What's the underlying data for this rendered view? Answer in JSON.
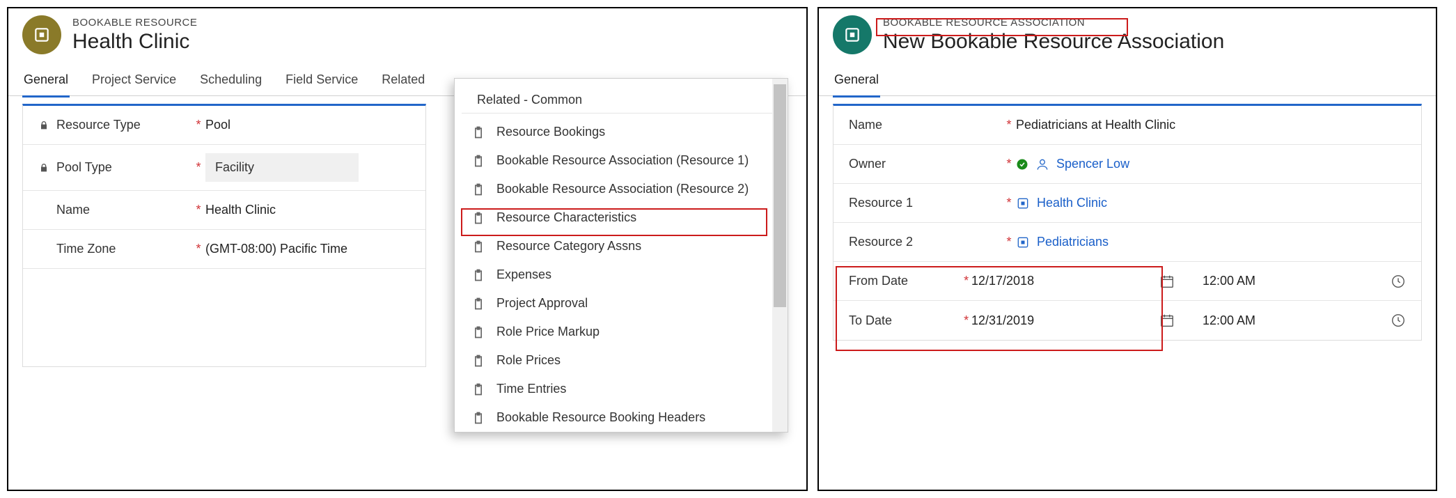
{
  "left": {
    "entity_label": "BOOKABLE RESOURCE",
    "entity_title": "Health Clinic",
    "tabs": [
      "General",
      "Project Service",
      "Scheduling",
      "Field Service",
      "Related"
    ],
    "fields": {
      "resource_type": {
        "label": "Resource Type",
        "value": "Pool"
      },
      "pool_type": {
        "label": "Pool Type",
        "value": "Facility"
      },
      "name": {
        "label": "Name",
        "value": "Health Clinic"
      },
      "time_zone": {
        "label": "Time Zone",
        "value": "(GMT-08:00) Pacific Time"
      }
    },
    "dropdown": {
      "header": "Related - Common",
      "items": [
        "Resource Bookings",
        "Bookable Resource Association (Resource 1)",
        "Bookable Resource Association (Resource 2)",
        "Resource Characteristics",
        "Resource Category Assns",
        "Expenses",
        "Project Approval",
        "Role Price Markup",
        "Role Prices",
        "Time Entries",
        "Bookable Resource Booking Headers"
      ]
    }
  },
  "right": {
    "entity_label": "BOOKABLE RESOURCE ASSOCIATION",
    "entity_title": "New Bookable Resource Association",
    "tabs": [
      "General"
    ],
    "fields": {
      "name": {
        "label": "Name",
        "value": "Pediatricians at Health Clinic"
      },
      "owner": {
        "label": "Owner",
        "value": "Spencer Low"
      },
      "resource1": {
        "label": "Resource 1",
        "value": "Health Clinic"
      },
      "resource2": {
        "label": "Resource 2",
        "value": "Pediatricians"
      },
      "from_date": {
        "label": "From Date",
        "date": "12/17/2018",
        "time": "12:00 AM"
      },
      "to_date": {
        "label": "To Date",
        "date": "12/31/2019",
        "time": "12:00 AM"
      }
    }
  }
}
